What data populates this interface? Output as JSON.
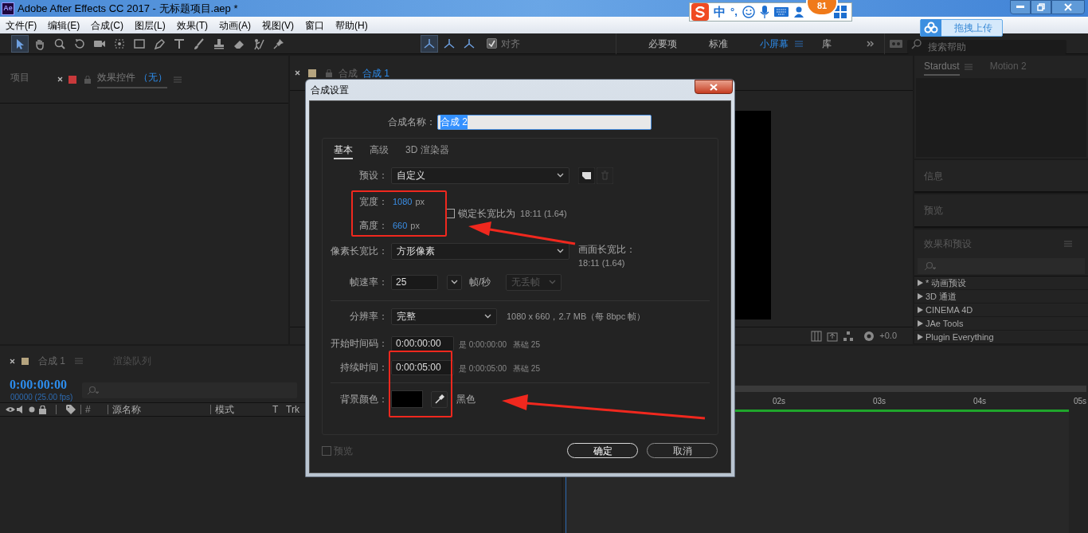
{
  "window": {
    "app_icon": "Ae",
    "title": "Adobe After Effects CC 2017 - 无标题项目.aep *"
  },
  "menu": [
    "文件(F)",
    "编辑(E)",
    "合成(C)",
    "图层(L)",
    "效果(T)",
    "动画(A)",
    "视图(V)",
    "窗口",
    "帮助(H)"
  ],
  "tools": [
    {
      "kind": "select",
      "selected": true
    },
    {
      "kind": "hand",
      "selected": false
    },
    {
      "kind": "zoom",
      "selected": false
    },
    {
      "kind": "rotate",
      "selected": false
    },
    {
      "kind": "camera",
      "selected": false
    },
    {
      "kind": "pan",
      "selected": false
    },
    {
      "kind": "rect",
      "selected": false
    },
    {
      "kind": "pen",
      "selected": false
    },
    {
      "kind": "text",
      "selected": false
    },
    {
      "kind": "brush",
      "selected": false
    },
    {
      "kind": "stamp",
      "selected": false
    },
    {
      "kind": "eraser",
      "selected": false
    },
    {
      "kind": "roto",
      "selected": false
    },
    {
      "kind": "pin",
      "selected": false
    },
    {
      "kind": "axis",
      "selected": true
    },
    {
      "kind": "axis",
      "selected": false
    },
    {
      "kind": "axis",
      "selected": false
    }
  ],
  "snap": {
    "label": "对齐",
    "checked": true
  },
  "workspaces": [
    {
      "label": "必要项",
      "selected": false
    },
    {
      "label": "标准",
      "selected": false
    },
    {
      "label": "小屏幕",
      "selected": true
    },
    {
      "label": "库",
      "selected": false
    }
  ],
  "search": {
    "placeholder": "搜索帮助"
  },
  "ime_bar": {
    "mode": "中",
    "punctuation": "°,",
    "badge": "81"
  },
  "upload_button": {
    "label": "拖拽上传"
  },
  "left_panel": {
    "tabs": [
      {
        "label": "项目",
        "selected": false
      },
      {
        "label": "效果控件",
        "suffix": "（无）",
        "selected": true
      }
    ]
  },
  "viewer": {
    "tab_prefix": "合成",
    "tab_label": "合成 1",
    "exposure": "+0.0"
  },
  "right_panel": {
    "tabs": [
      {
        "label": "Stardust",
        "selected": true
      },
      {
        "label": "Motion 2",
        "selected": false
      }
    ],
    "sections": [
      "信息",
      "预览"
    ],
    "effects_title": "效果和预设",
    "effects": [
      "* 动画预设",
      "3D 通道",
      "CINEMA 4D",
      "JAe Tools",
      "Plugin Everything"
    ]
  },
  "timeline": {
    "tabs": [
      {
        "label": "合成 1",
        "selected": true
      },
      {
        "label": "渲染队列",
        "selected": false
      }
    ],
    "timecode": "0:00:00:00",
    "frames": "00000 (25.00 fps)",
    "columns": [
      "#",
      "源名称",
      "模式",
      "T",
      "Trk"
    ],
    "ruler": [
      "02s",
      "03s",
      "04s",
      "05s"
    ]
  },
  "dialog": {
    "title": "合成设置",
    "name_label": "合成名称：",
    "name_value": "合成 2",
    "tabs": [
      {
        "label": "基本",
        "selected": true
      },
      {
        "label": "高级",
        "selected": false
      },
      {
        "label": "3D 渲染器",
        "selected": false
      }
    ],
    "preset_label": "预设：",
    "preset_value": "自定义",
    "width_label": "宽度：",
    "width_value": "1080",
    "height_label": "高度：",
    "height_value": "660",
    "width_unit": "px",
    "height_unit": "px",
    "lock": {
      "label": "锁定长宽比为",
      "ratio": "18:11 (1.64)",
      "checked": false
    },
    "pixel_label": "像素长宽比：",
    "pixel_value": "方形像素",
    "frame_label": "画面长宽比：",
    "frame_value": "18:11 (1.64)",
    "fps_label": "帧速率：",
    "fps_value": "25",
    "fps_unit": "帧/秒",
    "drop_value": "无丢帧",
    "res_label": "分辨率：",
    "res_value": "完整",
    "res_info": "1080 x 660，2.7 MB（每 8bpc 帧）",
    "start_label": "开始时间码：",
    "start_value": "0:00:00:00",
    "start_is": "是 0:00:00:00",
    "start_base": "基础 25",
    "dur_label": "持续时间：",
    "dur_value": "0:00:05:00",
    "dur_is": "是 0:00:05:00",
    "dur_base": "基础 25",
    "bg_label": "背景颜色：",
    "bg_name": "黑色",
    "preview": {
      "label": "预览",
      "checked": false
    },
    "buttons": [
      {
        "label": "确定",
        "kind": "primary"
      },
      {
        "label": "取消",
        "kind": "secondary"
      }
    ]
  }
}
